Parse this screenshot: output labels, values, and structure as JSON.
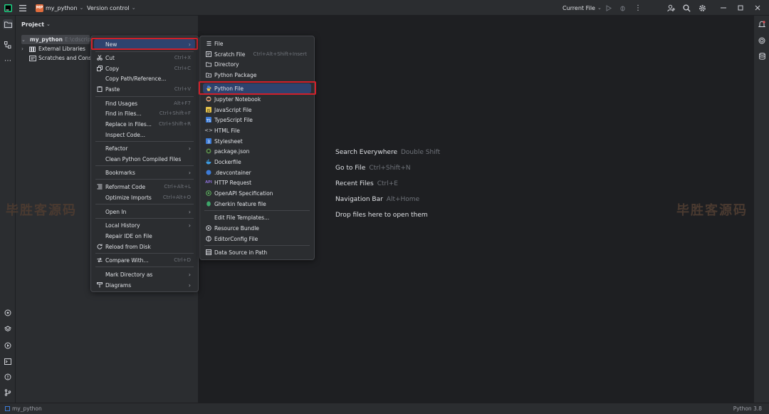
{
  "titlebar": {
    "project_name": "my_python",
    "project_badge": "MP",
    "version_control": "Version control",
    "run_config": "Current File"
  },
  "project_panel": {
    "title": "Project",
    "tree": [
      {
        "label": "my_python",
        "suffix": "E:\\cdscrip"
      },
      {
        "label": "External Libraries"
      },
      {
        "label": "Scratches and Consoles"
      }
    ]
  },
  "context_menu": [
    {
      "label": "New",
      "submenu": true,
      "selected": true
    },
    {
      "label": "Cut",
      "shortcut": "Ctrl+X",
      "icon": "cut-icon"
    },
    {
      "label": "Copy",
      "shortcut": "Ctrl+C",
      "icon": "copy-icon"
    },
    {
      "label": "Copy Path/Reference..."
    },
    {
      "label": "Paste",
      "shortcut": "Ctrl+V",
      "icon": "paste-icon"
    },
    {
      "label": "Find Usages",
      "shortcut": "Alt+F7"
    },
    {
      "label": "Find in Files...",
      "shortcut": "Ctrl+Shift+F"
    },
    {
      "label": "Replace in Files...",
      "shortcut": "Ctrl+Shift+R"
    },
    {
      "label": "Inspect Code..."
    },
    {
      "label": "Refactor",
      "submenu": true
    },
    {
      "label": "Clean Python Compiled Files"
    },
    {
      "label": "Bookmarks",
      "submenu": true
    },
    {
      "label": "Reformat Code",
      "shortcut": "Ctrl+Alt+L",
      "icon": "reformat-icon"
    },
    {
      "label": "Optimize Imports",
      "shortcut": "Ctrl+Alt+O"
    },
    {
      "label": "Open In",
      "submenu": true
    },
    {
      "label": "Local History",
      "submenu": true
    },
    {
      "label": "Repair IDE on File"
    },
    {
      "label": "Reload from Disk",
      "icon": "reload-icon"
    },
    {
      "label": "Compare With...",
      "shortcut": "Ctrl+D",
      "icon": "compare-icon"
    },
    {
      "label": "Mark Directory as",
      "submenu": true
    },
    {
      "label": "Diagrams",
      "submenu": true,
      "icon": "diagram-icon"
    }
  ],
  "new_submenu": [
    {
      "label": "File",
      "icon": "file-icon"
    },
    {
      "label": "Scratch File",
      "shortcut": "Ctrl+Alt+Shift+Insert",
      "icon": "scratch-file-icon"
    },
    {
      "label": "Directory",
      "icon": "folder-icon"
    },
    {
      "label": "Python Package",
      "icon": "package-icon"
    },
    {
      "label": "Python File",
      "icon": "python-icon",
      "selected": true
    },
    {
      "label": "Jupyter Notebook",
      "icon": "jupyter-icon"
    },
    {
      "label": "JavaScript File",
      "icon": "javascript-icon"
    },
    {
      "label": "TypeScript File",
      "icon": "typescript-icon"
    },
    {
      "label": "HTML File",
      "icon": "html-icon"
    },
    {
      "label": "Stylesheet",
      "icon": "css-icon"
    },
    {
      "label": "package.json",
      "icon": "npm-icon"
    },
    {
      "label": "Dockerfile",
      "icon": "docker-icon"
    },
    {
      "label": ".devcontainer",
      "icon": "devcontainer-icon"
    },
    {
      "label": "HTTP Request",
      "icon": "http-icon"
    },
    {
      "label": "OpenAPI Specification",
      "icon": "openapi-icon"
    },
    {
      "label": "Gherkin feature file",
      "icon": "gherkin-icon"
    },
    {
      "label": "Edit File Templates..."
    },
    {
      "label": "Resource Bundle",
      "icon": "resource-bundle-icon"
    },
    {
      "label": "EditorConfig File",
      "icon": "editorconfig-icon"
    },
    {
      "label": "Data Source in Path",
      "icon": "datasource-icon"
    }
  ],
  "welcome_hints": [
    {
      "label": "Search Everywhere",
      "shortcut": "Double Shift"
    },
    {
      "label": "Go to File",
      "shortcut": "Ctrl+Shift+N"
    },
    {
      "label": "Recent Files",
      "shortcut": "Ctrl+E"
    },
    {
      "label": "Navigation Bar",
      "shortcut": "Alt+Home"
    },
    {
      "label": "Drop files here to open them",
      "shortcut": ""
    }
  ],
  "watermark": "毕胜客源码",
  "statusbar": {
    "breadcrumb": "my_python",
    "interpreter": "Python 3.8"
  },
  "colors": {
    "accent": "#2e436e",
    "highlight_box": "#d0202a",
    "background": "#1e1f22",
    "panel": "#2b2d30"
  }
}
